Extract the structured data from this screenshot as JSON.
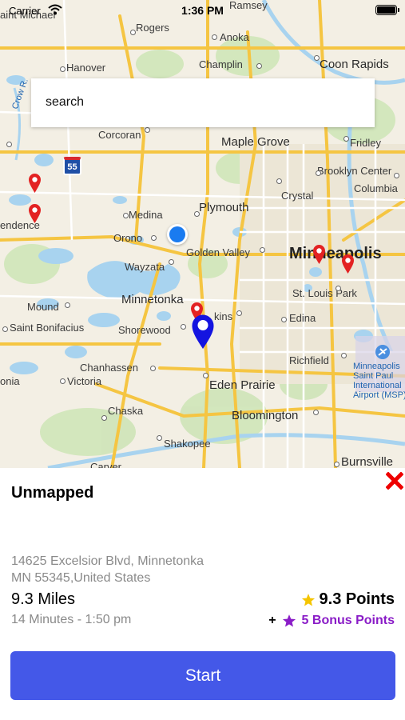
{
  "status_bar": {
    "carrier": "Carrier",
    "time": "1:36 PM"
  },
  "search": {
    "placeholder": "search"
  },
  "map": {
    "place_labels": {
      "ramsey": "Ramsey",
      "st_michael": "aint Michael",
      "rogers": "Rogers",
      "anoka": "Anoka",
      "coon_rapids": "Coon Rapids",
      "hanover": "Hanover",
      "champlin": "Champlin",
      "crow_river": "Crow R.",
      "corcoran": "Corcoran",
      "maple_grove": "Maple Grove",
      "fridley": "Fridley",
      "brooklyn_center": "Brooklyn Center",
      "columbia": "Columbia",
      "crystal": "Crystal",
      "medina": "Medina",
      "plymouth": "Plymouth",
      "independence": "endence",
      "orono": "Orono",
      "golden_valley": "Golden Valley",
      "minneapolis": "Minneapolis",
      "wayzata": "Wayzata",
      "st_louis_park": "St. Louis Park",
      "minnetonka": "Minnetonka",
      "mound": "Mound",
      "hopkins": "kins",
      "edina": "Edina",
      "saint_bonifacius": "Saint Bonifacius",
      "shorewood": "Shorewood",
      "richfield": "Richfield",
      "chanhassen": "Chanhassen",
      "victoria": "Victoria",
      "waconia": "onia",
      "eden_prairie": "Eden Prairie",
      "airport": [
        "Minneapolis",
        "Saint Paul",
        "International",
        "Airport (MSP)"
      ],
      "chaska": "Chaska",
      "bloomington": "Bloomington",
      "shakopee": "Shakopee",
      "carver": "Carver",
      "burnsville": "Burnsville"
    },
    "highway_shield": "55",
    "colors": {
      "pin_red": "#e32222",
      "pin_blue": "#1414e0",
      "user_location": "#1a7bf0"
    }
  },
  "detail": {
    "title": "Unmapped",
    "address_line1": "14625 Excelsior Blvd, Minnetonka",
    "address_line2": "MN 55345,United States",
    "distance": "9.3 Miles",
    "eta": "14 Minutes - 1:50 pm",
    "points": "9.3 Points",
    "bonus_prefix": "+",
    "bonus_points": "5 Bonus Points",
    "start_label": "Start",
    "colors": {
      "star_gold": "#f5c500",
      "bonus_purple": "#8a1cc7",
      "start_button": "#4458e8",
      "close_red": "#ee0000"
    }
  }
}
